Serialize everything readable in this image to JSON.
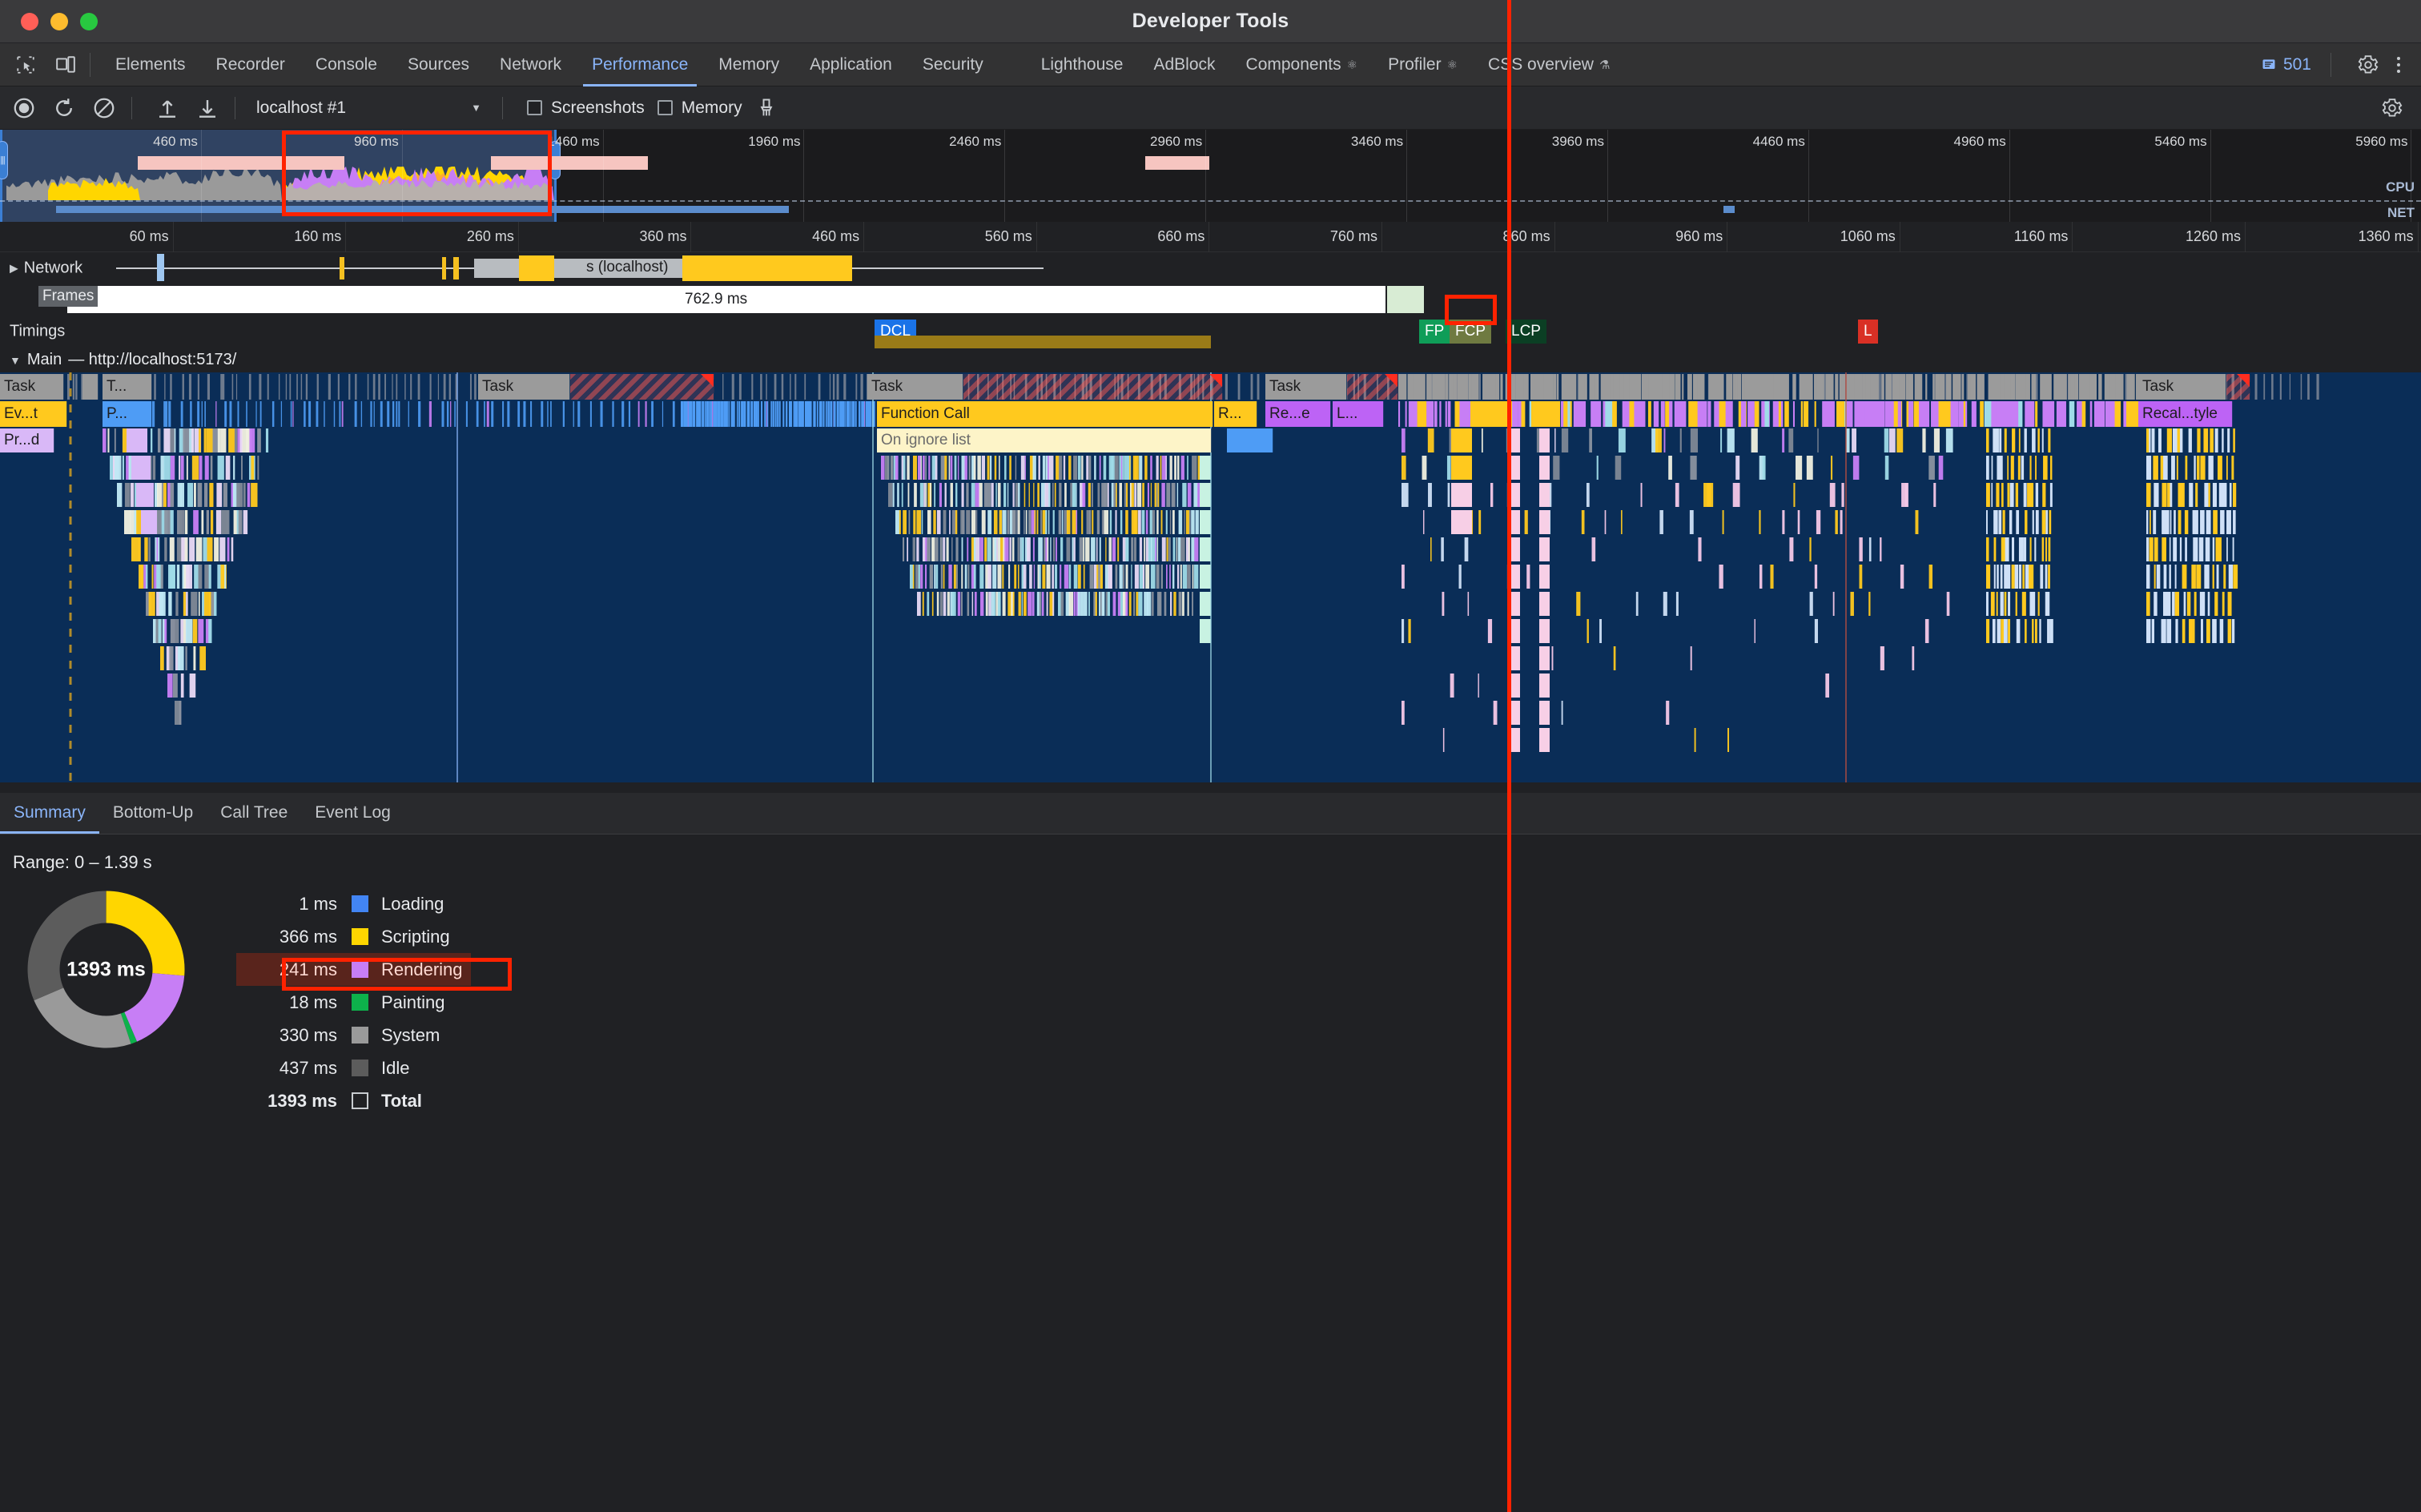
{
  "window": {
    "title": "Developer Tools"
  },
  "tabs": {
    "icons": [
      {
        "name": "inspect-element-icon",
        "glyph": "⬚"
      },
      {
        "name": "device-toolbar-icon",
        "glyph": "▭"
      }
    ],
    "items": [
      {
        "label": "Elements",
        "active": false
      },
      {
        "label": "Recorder",
        "active": false
      },
      {
        "label": "Console",
        "active": false
      },
      {
        "label": "Sources",
        "active": false
      },
      {
        "label": "Network",
        "active": false
      },
      {
        "label": "Performance",
        "active": true
      },
      {
        "label": "Memory",
        "active": false
      },
      {
        "label": "Application",
        "active": false
      },
      {
        "label": "Security",
        "active": false
      },
      {
        "label": "Lighthouse",
        "active": false
      },
      {
        "label": "AdBlock",
        "active": false
      },
      {
        "label": "Components",
        "active": false,
        "sup": "⚛"
      },
      {
        "label": "Profiler",
        "active": false,
        "sup": "⚛"
      },
      {
        "label": "CSS overview",
        "active": false,
        "sup": "⚗"
      }
    ],
    "message_count": "501",
    "settings_icon": "gear-icon",
    "more_icon": "kebab-menu-icon"
  },
  "perf_toolbar": {
    "record_icon": "record-circle-icon",
    "reload_icon": "reload-record-icon",
    "clear_icon": "clear-icon",
    "upload_icon": "upload-profile-icon",
    "download_icon": "download-profile-icon",
    "profile_select": "localhost #1",
    "screenshots_label": "Screenshots",
    "screenshots_checked": false,
    "memory_label": "Memory",
    "memory_checked": false,
    "gc_icon": "collect-garbage-icon",
    "capture_settings_icon": "capture-settings-gear-icon"
  },
  "overview": {
    "ticks": [
      "460 ms",
      "960 ms",
      "1460 ms",
      "1960 ms",
      "2460 ms",
      "2960 ms",
      "3460 ms",
      "3960 ms",
      "4460 ms",
      "4960 ms",
      "5460 ms",
      "5960 ms"
    ],
    "cpu_label": "CPU",
    "net_label": "NET",
    "selection_start_ms": 0,
    "selection_end_ms": 1390
  },
  "main_ruler": {
    "ticks": [
      "60 ms",
      "160 ms",
      "260 ms",
      "360 ms",
      "460 ms",
      "560 ms",
      "660 ms",
      "760 ms",
      "860 ms",
      "960 ms",
      "1060 ms",
      "1160 ms",
      "1260 ms",
      "1360 ms"
    ]
  },
  "rows": {
    "network": {
      "label": "Network",
      "expand_icon": "triangle-right-icon",
      "request_label": "s (localhost)"
    },
    "frames": {
      "label": "Frames",
      "duration": "762.9 ms"
    },
    "timings": {
      "label": "Timings",
      "markers": [
        {
          "id": "DCL",
          "label": "DCL"
        },
        {
          "id": "FP",
          "label": "FP"
        },
        {
          "id": "FCP",
          "label": "FCP"
        },
        {
          "id": "LCP",
          "label": "LCP"
        },
        {
          "id": "L",
          "label": "L"
        }
      ]
    },
    "main": {
      "label": "Main",
      "url": "— http://localhost:5173/",
      "expand_icon": "triangle-down-icon",
      "bars": [
        {
          "label": "Task"
        },
        {
          "label": "T..."
        },
        {
          "label": "Task"
        },
        {
          "label": "Task"
        },
        {
          "label": "Task"
        },
        {
          "label": "Ev...t"
        },
        {
          "label": "P..."
        },
        {
          "label": "Function Call"
        },
        {
          "label": "R..."
        },
        {
          "label": "Re...e"
        },
        {
          "label": "L..."
        },
        {
          "label": "Recal...tyle"
        },
        {
          "label": "Pr...d"
        },
        {
          "label": "On ignore list"
        }
      ]
    }
  },
  "drawer": {
    "tabs": [
      {
        "label": "Summary",
        "active": true
      },
      {
        "label": "Bottom-Up",
        "active": false
      },
      {
        "label": "Call Tree",
        "active": false
      },
      {
        "label": "Event Log",
        "active": false
      }
    ],
    "range": "Range: 0 – 1.39 s"
  },
  "chart_data": {
    "type": "pie",
    "title": "Range: 0 – 1.39 s",
    "center_label": "1393 ms",
    "categories": [
      "Loading",
      "Scripting",
      "Rendering",
      "Painting",
      "System",
      "Idle"
    ],
    "values": [
      1,
      366,
      241,
      18,
      330,
      437
    ],
    "value_labels": [
      "1 ms",
      "366 ms",
      "241 ms",
      "18 ms",
      "330 ms",
      "437 ms"
    ],
    "colors": [
      "#4285f4",
      "#ffd600",
      "#c77ef5",
      "#0db14b",
      "#9a9a9a",
      "#5c5c5c"
    ],
    "total_label": "Total",
    "total_value": "1393 ms",
    "total_ms": 1393,
    "highlighted": "Rendering",
    "legend_position": "right",
    "donut": true
  },
  "annotations": {
    "accent_color": "#ff2200",
    "boxes": [
      "overview-selection-box",
      "fcp-marker-box",
      "rendering-legend-box"
    ],
    "playhead_label": "playhead-vertical-line"
  }
}
